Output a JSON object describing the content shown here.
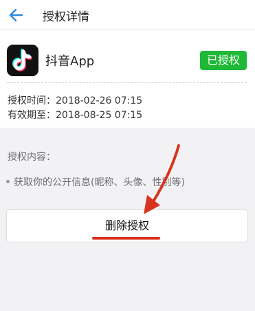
{
  "header": {
    "title": "授权详情",
    "back_icon": "arrow-left-icon"
  },
  "app": {
    "name": "抖音App",
    "icon": "tiktok-logo",
    "status": "已授权"
  },
  "authorization": {
    "time_label": "授权时间：",
    "time_value": "2018-02-26 07:15",
    "expiry_label": "有效期至：",
    "expiry_value": "2018-08-25 07:15"
  },
  "permissions": {
    "title": "授权内容：",
    "items": [
      "获取你的公开信息(昵称、头像、性别等)"
    ]
  },
  "actions": {
    "delete_label": "删除授权"
  },
  "colors": {
    "accent": "#2a8ae0",
    "status_green": "#1fb837",
    "annotation_red": "#d8331f"
  }
}
